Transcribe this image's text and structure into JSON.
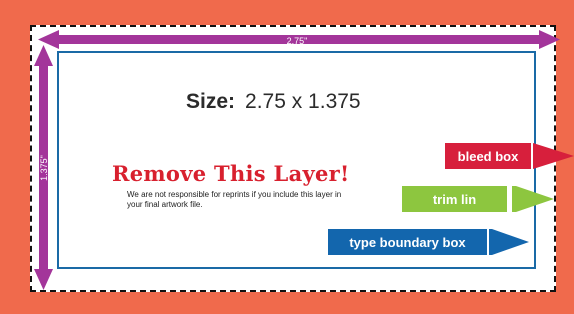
{
  "dimensions": {
    "width_label": "2.75\"",
    "height_label": "1.375\""
  },
  "size": {
    "label": "Size:",
    "value": "2.75 x 1.375"
  },
  "notice": {
    "title": "Remove This Layer!",
    "text": "We are not responsible for reprints if you include this layer in your final artwork file."
  },
  "legend": {
    "bleed": "bleed box",
    "trim": "trim lin",
    "type": "type boundary box"
  },
  "colors": {
    "bleed_area": "#f06a4c",
    "dimension_arrows": "#a3359a",
    "bleed_tag": "#d71f3c",
    "trim_tag": "#8dc63f",
    "type_tag": "#1366ad",
    "remove_title": "#d8202e"
  }
}
